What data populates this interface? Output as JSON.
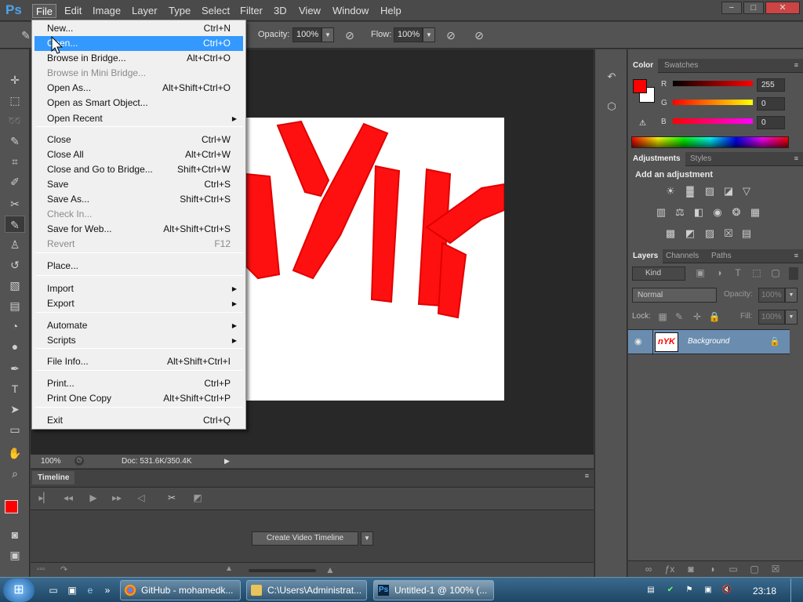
{
  "app": {
    "logo": "Ps"
  },
  "menubar": [
    "File",
    "Edit",
    "Image",
    "Layer",
    "Type",
    "Select",
    "Filter",
    "3D",
    "View",
    "Window",
    "Help"
  ],
  "window_buttons": [
    "−",
    "□",
    "✕"
  ],
  "options": {
    "opacity_label": "Opacity:",
    "opacity_value": "100%",
    "flow_label": "Flow:",
    "flow_value": "100%"
  },
  "file_menu": {
    "items": [
      {
        "label": "New...",
        "shortcut": "Ctrl+N"
      },
      {
        "label": "Open...",
        "shortcut": "Ctrl+O",
        "highlighted": true
      },
      {
        "label": "Browse in Bridge...",
        "shortcut": "Alt+Ctrl+O"
      },
      {
        "label": "Browse in Mini Bridge...",
        "shortcut": "",
        "disabled": true
      },
      {
        "label": "Open As...",
        "shortcut": "Alt+Shift+Ctrl+O"
      },
      {
        "label": "Open as Smart Object...",
        "shortcut": ""
      },
      {
        "label": "Open Recent",
        "shortcut": "",
        "submenu": true
      },
      {
        "label": "Close",
        "shortcut": "Ctrl+W"
      },
      {
        "label": "Close All",
        "shortcut": "Alt+Ctrl+W"
      },
      {
        "label": "Close and Go to Bridge...",
        "shortcut": "Shift+Ctrl+W"
      },
      {
        "label": "Save",
        "shortcut": "Ctrl+S"
      },
      {
        "label": "Save As...",
        "shortcut": "Shift+Ctrl+S"
      },
      {
        "label": "Check In...",
        "shortcut": "",
        "disabled": true
      },
      {
        "label": "Save for Web...",
        "shortcut": "Alt+Shift+Ctrl+S"
      },
      {
        "label": "Revert",
        "shortcut": "F12",
        "disabled": true
      },
      {
        "label": "Place...",
        "shortcut": ""
      },
      {
        "label": "Import",
        "shortcut": "",
        "submenu": true
      },
      {
        "label": "Export",
        "shortcut": "",
        "submenu": true
      },
      {
        "label": "Automate",
        "shortcut": "",
        "submenu": true
      },
      {
        "label": "Scripts",
        "shortcut": "",
        "submenu": true
      },
      {
        "label": "File Info...",
        "shortcut": "Alt+Shift+Ctrl+I"
      },
      {
        "label": "Print...",
        "shortcut": "Ctrl+P"
      },
      {
        "label": "Print One Copy",
        "shortcut": "Alt+Shift+Ctrl+P"
      },
      {
        "label": "Exit",
        "shortcut": "Ctrl+Q"
      }
    ],
    "submenu_arrow": "▶"
  },
  "canvas": {
    "text": "nYK",
    "color": "#ff0000"
  },
  "status": {
    "zoom": "100%",
    "doc": "Doc: 531.6K/350.4K"
  },
  "timeline": {
    "tab": "Timeline",
    "create_button": "Create Video Timeline"
  },
  "color_panel": {
    "tabs": [
      "Color",
      "Swatches"
    ],
    "channels": [
      {
        "name": "R",
        "value": "255"
      },
      {
        "name": "G",
        "value": "0"
      },
      {
        "name": "B",
        "value": "0"
      }
    ],
    "foreground": "#ff0000"
  },
  "adjustments_panel": {
    "tabs": [
      "Adjustments",
      "Styles"
    ],
    "heading": "Add an adjustment"
  },
  "layers_panel": {
    "tabs": [
      "Layers",
      "Channels",
      "Paths"
    ],
    "filter_kind": "Kind",
    "blend_mode": "Normal",
    "opacity_label": "Opacity:",
    "opacity_value": "100%",
    "lock_label": "Lock:",
    "fill_label": "Fill:",
    "fill_value": "100%",
    "layer": {
      "name": "Background",
      "thumb_text": "nYK"
    }
  },
  "taskbar": {
    "tasks": [
      {
        "label": "GitHub - mohamedk..."
      },
      {
        "label": "C:\\Users\\Administrat..."
      },
      {
        "label": "Untitled-1 @ 100% (..."
      }
    ],
    "clock": "23:18"
  }
}
